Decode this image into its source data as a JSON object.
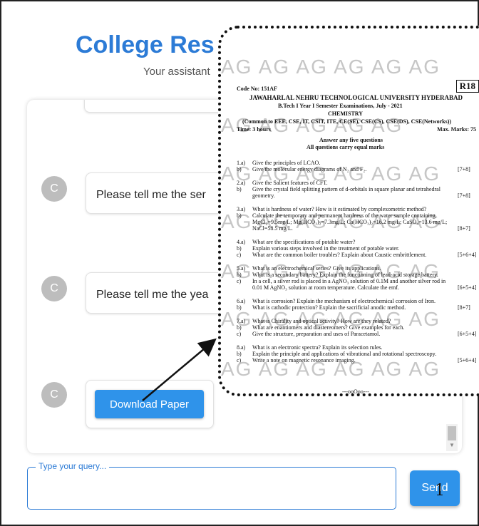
{
  "app": {
    "title": "College Res",
    "subtitle": "Your assistant"
  },
  "chat": {
    "messages": [
      {
        "avatar": "C",
        "text": "Please tell me the ser"
      },
      {
        "avatar": "C",
        "text": "Please tell me the yea"
      }
    ],
    "download": {
      "avatar": "C",
      "label": "Download Paper"
    }
  },
  "composer": {
    "legend": "Type your query...",
    "value": "",
    "send_label": "Send",
    "cursor_mark": "1"
  },
  "paper": {
    "watermark": "AG",
    "code": "Code No: 151AF",
    "regulation": "R18",
    "university": "JAWAHARLAL NEHRU TECHNOLOGICAL UNIVERSITY HYDERABAD",
    "exam": "B.Tech I Year I Semester Examinations, July - 2021",
    "subject": "CHEMISTRY",
    "branches": "(Common to EEE, CSE, IT, CSIT, ITE, CE(SE), CSE(CS), CSE(DS), CSE(Networks))",
    "time": "Time: 3 hours",
    "max_marks": "Max. Marks: 75",
    "instruction1": "Answer any five questions",
    "instruction2": "All questions carry equal marks",
    "questions": [
      {
        "no": "1.a)",
        "text": "Give the principles of LCAO."
      },
      {
        "no": "b)",
        "text": "Give the molecular energy diagrams of N₂ and F₂.",
        "marks": "[7+8]"
      },
      {
        "no": "2.a)",
        "text": "Give the Salient features of CFT."
      },
      {
        "no": "b)",
        "text": "Give the crystal field splitting pattern of d-orbitals in square planar and tetrahedral"
      },
      {
        "no": "",
        "text": "geometry.",
        "marks": "[7+8]"
      },
      {
        "no": "3.a)",
        "text": "What is hardness of water? How is it estimated by complexometric method?"
      },
      {
        "no": "b)",
        "text": "Calculate the temporary and permanent hardness of the water sample containing"
      },
      {
        "no": "",
        "text": "MgCl₂=9.5mg/L; Mg(HCO₃)₂=7.3mg/L; Ca(HCO₃)₂=16.2 mg/L; CaSO₄=13.6 mg/L;"
      },
      {
        "no": "",
        "text": "NaCl=58.5 mg/L.",
        "marks": "[8+7]"
      },
      {
        "no": "4.a)",
        "text": "What are the specifications of potable water?"
      },
      {
        "no": "b)",
        "text": "Explain various steps involved in the treatment of potable water."
      },
      {
        "no": "c)",
        "text": "What are the common boiler troubles? Explain about Caustic embrittlement.",
        "marks": "[5+6+4]"
      },
      {
        "no": "5.a)",
        "text": "What is an electrochemical series? Give its applications."
      },
      {
        "no": "b)",
        "text": "What is a secondary battery? Explain the functioning of lead-acid storage battery."
      },
      {
        "no": "c)",
        "text": "In a cell, a silver rod is placed in a AgNO₃ solution of 0.1M and another silver rod in"
      },
      {
        "no": "",
        "text": "0.01 M AgNO₃ solution at room temperature. Calculate the emf.",
        "marks": "[6+5+4]"
      },
      {
        "no": "6.a)",
        "text": "What is corrosion? Explain the mechanism of electrochemical corrosion of Iron."
      },
      {
        "no": "b)",
        "text": "What is cathodic protection? Explain the sacrificial anodic method.",
        "marks": "[8+7]"
      },
      {
        "no": "7.a)",
        "text": "What is Chirality and optical activity? How are they related?"
      },
      {
        "no": "b)",
        "text": "What are enantiomers and diastereomers? Give examples for each."
      },
      {
        "no": "c)",
        "text": "Give the structure, preparation and uses of Paracetamol.",
        "marks": "[6+5+4]"
      },
      {
        "no": "8.a)",
        "text": "What is an electronic spectra? Explain its selection rules."
      },
      {
        "no": "b)",
        "text": "Explain the principle and applications of vibrational and rotational spectroscopy."
      },
      {
        "no": "c)",
        "text": "Write a note on magnetic resonance imaging.",
        "marks": "[5+6+4]"
      }
    ],
    "footer": "---ooOoo---"
  },
  "colors": {
    "accent": "#2c7bd6",
    "button": "#2f93ea",
    "avatar": "#bdbdbd"
  }
}
